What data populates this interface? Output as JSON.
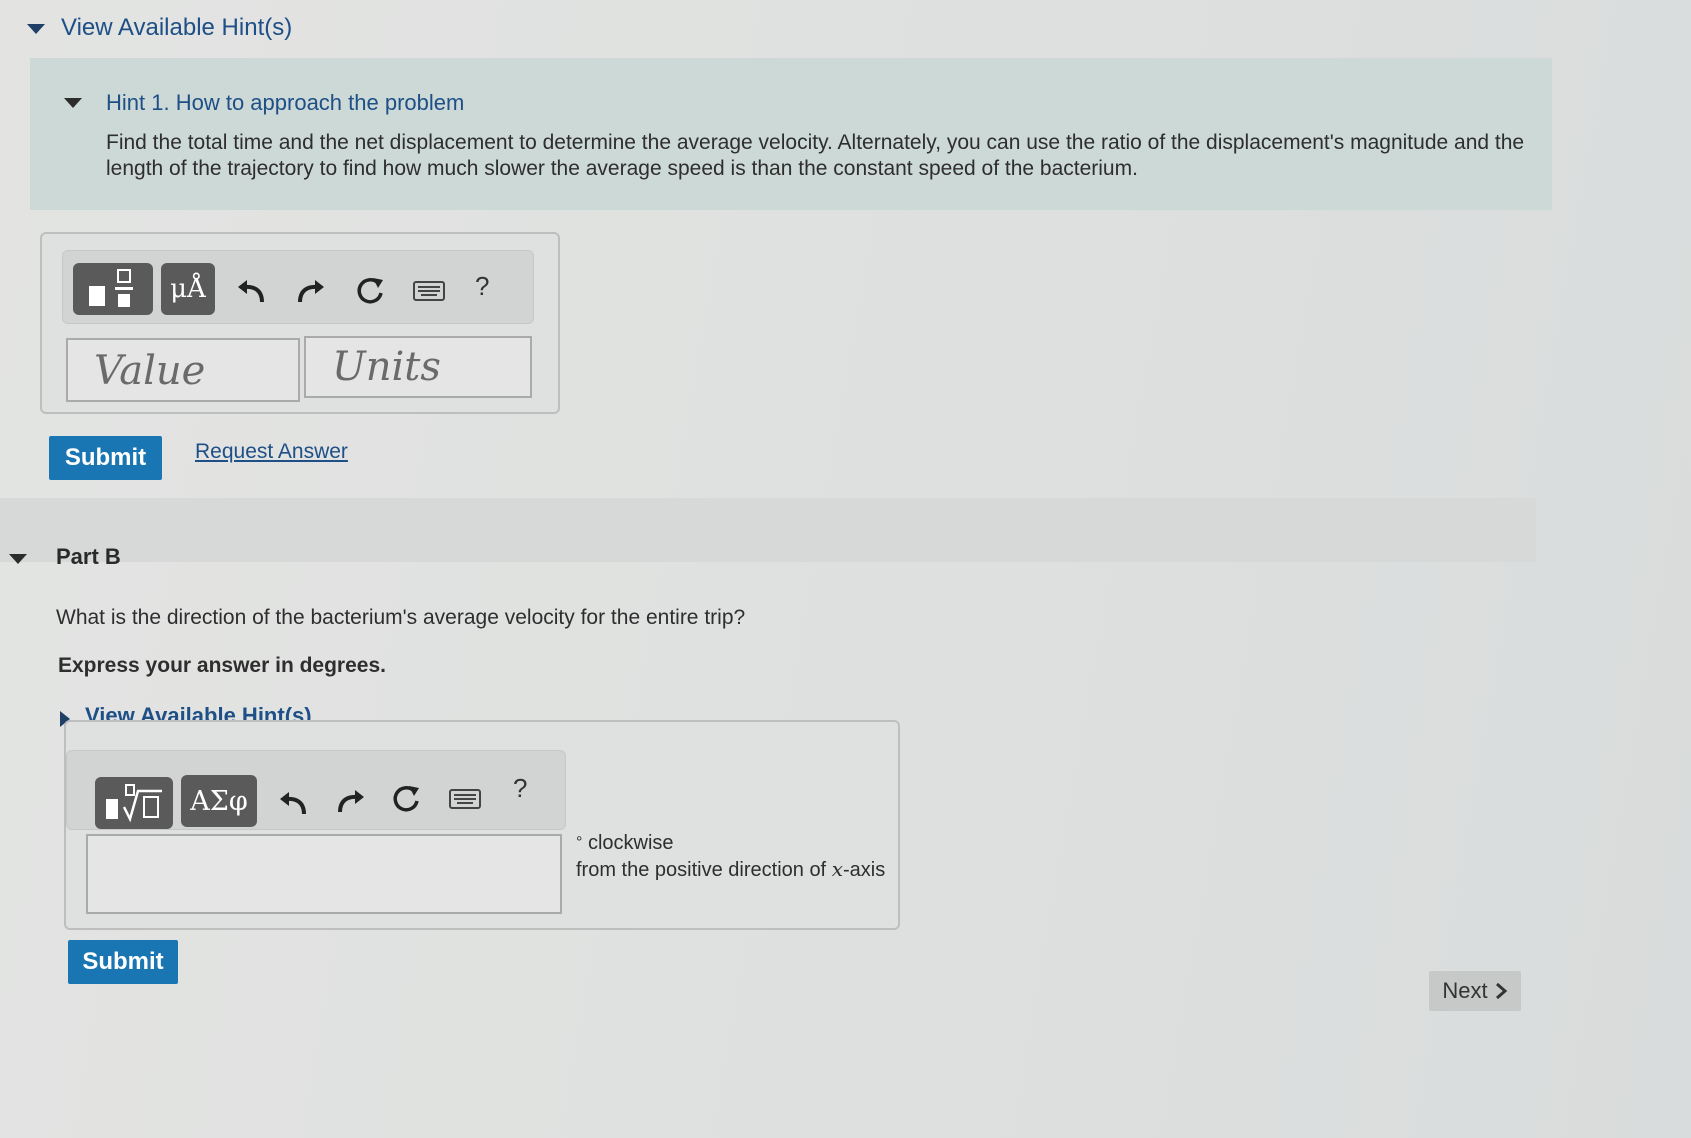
{
  "hints_section": {
    "label": "View Available Hint(s)"
  },
  "hint1": {
    "number": "Hint 1.",
    "title": "How to approach the problem",
    "body": "Find the total time and the net displacement to determine the average velocity. Alternately, you can use the ratio of the displacement's magnitude and the length of the trajectory to find how much slower the average speed is than the constant speed of the bacterium."
  },
  "partA": {
    "toolbar": {
      "template_icon": "fraction-template-icon",
      "units_label": "μÅ",
      "undo_icon": "undo-icon",
      "redo_icon": "redo-icon",
      "reset_icon": "reset-icon",
      "keyboard_icon": "keyboard-icon",
      "help_label": "?"
    },
    "value_placeholder": "Value",
    "units_placeholder": "Units",
    "value": "",
    "units": "",
    "submit_label": "Submit",
    "request_answer_label": "Request Answer"
  },
  "partB": {
    "title": "Part B",
    "question": "What is the direction of the bacterium's average velocity for the entire trip?",
    "instruction": "Express your answer in degrees.",
    "hints_label": "View Available Hint(s)",
    "toolbar": {
      "template_icon": "sqrt-template-icon",
      "greek_label": "ΑΣφ",
      "undo_icon": "undo-icon",
      "redo_icon": "redo-icon",
      "reset_icon": "reset-icon",
      "keyboard_icon": "keyboard-icon",
      "help_label": "?"
    },
    "answer_value": "",
    "unit_degree": "°",
    "unit_direction": "clockwise",
    "unit_reference": "from the positive direction of",
    "unit_axis_var": "x",
    "unit_axis_suffix": "-axis",
    "submit_label": "Submit"
  },
  "nav": {
    "next_label": "Next",
    "next_icon": "chevron-right-icon"
  },
  "colors": {
    "link": "#1e4f86",
    "button": "#1a76b3",
    "hint_background": "#cdd9d6",
    "toolbar_button": "#5a5a5a"
  }
}
